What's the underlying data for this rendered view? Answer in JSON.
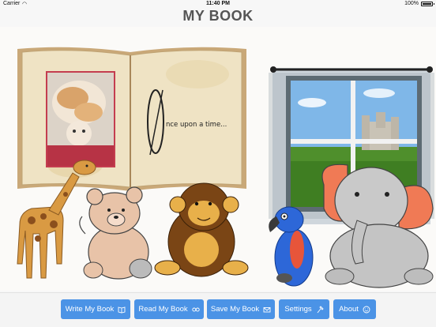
{
  "status": {
    "carrier": "Carrier",
    "time": "11:40 PM",
    "battery": "100%",
    "battery_level": 1.0
  },
  "title": "MY BOOK",
  "book": {
    "page_text": "nce upon a time...",
    "drop_cap": "O"
  },
  "toolbar": {
    "buttons": [
      {
        "label": "Write My Book",
        "icon": "book-icon"
      },
      {
        "label": "Read My Book",
        "icon": "glasses-icon"
      },
      {
        "label": "Save My Book",
        "icon": "envelope-icon"
      },
      {
        "label": "Settings",
        "icon": "hammer-icon"
      },
      {
        "label": "About",
        "icon": "smiley-icon"
      }
    ]
  },
  "colors": {
    "button": "#4b93e6",
    "title": "#555555",
    "book_page": "#efe2c0",
    "sky": "#7fb7e8",
    "grass": "#4f8f2c"
  }
}
